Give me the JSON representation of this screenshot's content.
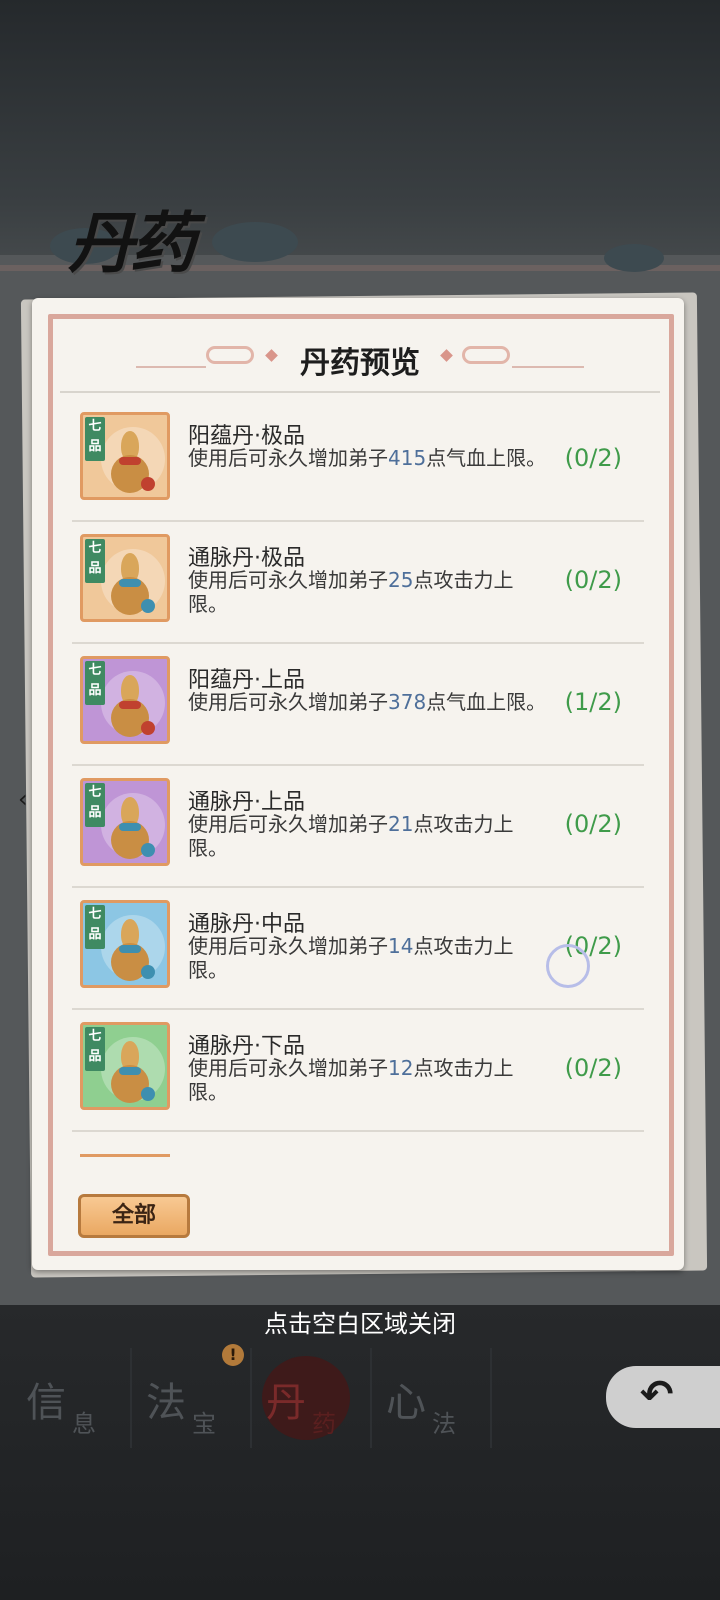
{
  "page": {
    "title": "丹药",
    "close_hint": "点击空白区域关闭"
  },
  "dialog": {
    "title": "丹药预览",
    "filter_button": "全部"
  },
  "items": [
    {
      "grade": "七品",
      "name": "阳蕴丹·极品",
      "desc_prefix": "使用后可永久增加弟子",
      "amount": "415",
      "desc_suffix": "点气血上限。",
      "count": "(0/2)",
      "rarity_color": "#f0c89a",
      "tie_color": "#c0412f"
    },
    {
      "grade": "七品",
      "name": "通脉丹·极品",
      "desc_prefix": "使用后可永久增加弟子",
      "amount": "25",
      "desc_suffix": "点攻击力上限。",
      "count": "(0/2)",
      "rarity_color": "#f0c89a",
      "tie_color": "#3e8fb0"
    },
    {
      "grade": "七品",
      "name": "阳蕴丹·上品",
      "desc_prefix": "使用后可永久增加弟子",
      "amount": "378",
      "desc_suffix": "点气血上限。",
      "count": "(1/2)",
      "rarity_color": "#bf95d6",
      "tie_color": "#c0412f"
    },
    {
      "grade": "七品",
      "name": "通脉丹·上品",
      "desc_prefix": "使用后可永久增加弟子",
      "amount": "21",
      "desc_suffix": "点攻击力上限。",
      "count": "(0/2)",
      "rarity_color": "#bf95d6",
      "tie_color": "#3e8fb0"
    },
    {
      "grade": "七品",
      "name": "通脉丹·中品",
      "desc_prefix": "使用后可永久增加弟子",
      "amount": "14",
      "desc_suffix": "点攻击力上限。",
      "count": "(0/2)",
      "rarity_color": "#8cc6e4",
      "tie_color": "#3e8fb0"
    },
    {
      "grade": "七品",
      "name": "通脉丹·下品",
      "desc_prefix": "使用后可永久增加弟子",
      "amount": "12",
      "desc_suffix": "点攻击力上限。",
      "count": "(0/2)",
      "rarity_color": "#8fcf90",
      "tie_color": "#3e8fb0"
    }
  ],
  "tabs": [
    {
      "big": "信",
      "small": "息",
      "active": false
    },
    {
      "big": "法",
      "small": "宝",
      "active": false
    },
    {
      "big": "丹",
      "small": "药",
      "active": true
    },
    {
      "big": "心",
      "small": "法",
      "active": false
    }
  ],
  "alert_icon": "!",
  "back_icon": "↶",
  "side_arrows": {
    "left": "‹",
    "right": "›"
  }
}
